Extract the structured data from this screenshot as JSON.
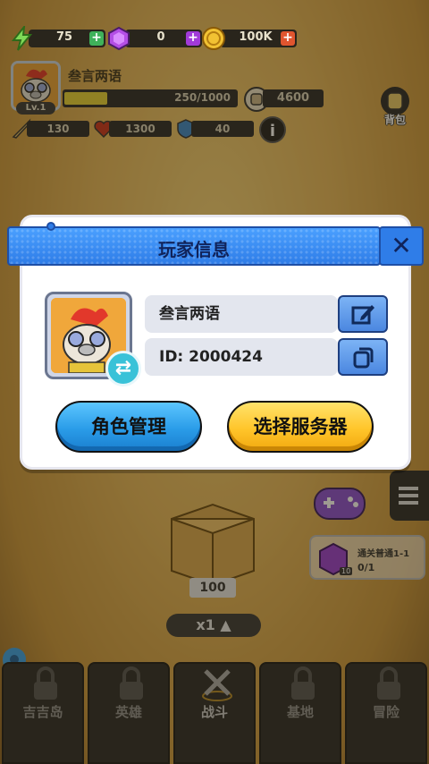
{
  "resources": {
    "energy": {
      "value": "75",
      "icon": "lightning-icon"
    },
    "gems": {
      "value": "0",
      "icon": "gem-icon"
    },
    "coins": {
      "value": "100K",
      "icon": "coin-icon"
    }
  },
  "profile": {
    "name": "叁言两语",
    "level": "Lv.1",
    "xp": "250/1000",
    "xp_fraction": 0.25,
    "power": "4600",
    "attack": "130",
    "health": "1300",
    "defense": "40"
  },
  "bag_label": "背包",
  "modal": {
    "title": "玩家信息",
    "player_name": "叁言两语",
    "player_id": "ID: 2000424",
    "role_button": "角色管理",
    "server_button": "选择服务器"
  },
  "quest": {
    "title": "通关普通1-1",
    "progress": "0/1",
    "badge": "10"
  },
  "reward_box": {
    "count": "100"
  },
  "multiplier": "x1",
  "nav": [
    {
      "label": "吉吉岛"
    },
    {
      "label": "英雄"
    },
    {
      "label": "战斗"
    },
    {
      "label": "基地"
    },
    {
      "label": "冒险"
    }
  ],
  "colors": {
    "modal_header": "#2f7de8",
    "button_blue": "#2a9ce8",
    "button_yellow": "#ffc52a",
    "background": "#e4b65c"
  }
}
